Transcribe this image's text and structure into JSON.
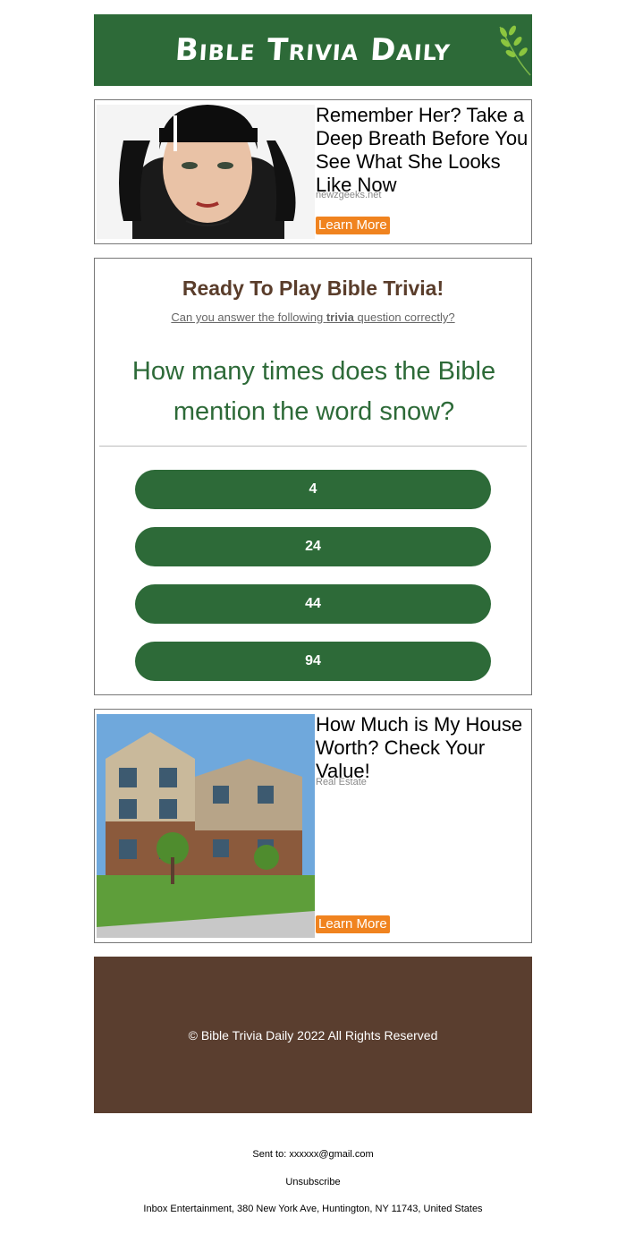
{
  "header": {
    "logo_text": "Bible Trivia Daily",
    "brand_color": "#2d6a38"
  },
  "ads": [
    {
      "title": "Remember Her? Take a Deep Breath Before You See What She Looks Like Now",
      "source": "newzgeeks.net",
      "cta": "Learn More",
      "image": "woman-black-pigtails-photo"
    },
    {
      "title": "How Much is My House Worth? Check Your Value!",
      "source": "Real Estate",
      "cta": "Learn More",
      "image": "apartment-building-photo"
    }
  ],
  "quiz": {
    "heading": "Ready To Play Bible Trivia!",
    "subtitle_before": "Can you answer the following ",
    "subtitle_bold": "trivia",
    "subtitle_after": " question correctly?",
    "question": "How many times does the Bible mention the word snow?",
    "answers": [
      "4",
      "24",
      "44",
      "94"
    ]
  },
  "footer": {
    "copyright": "© Bible Trivia Daily 2022 All Rights Reserved",
    "color": "#5a3e2f"
  },
  "meta": {
    "sent_to_label": "Sent to:",
    "sent_to_email": "xxxxxx@gmail.com",
    "unsubscribe": "Unsubscribe",
    "address": "Inbox Entertainment, 380 New York Ave, Huntington, NY 11743, United States"
  },
  "colors": {
    "accent_orange": "#f0831f",
    "heading_brown": "#5a3d2b"
  }
}
